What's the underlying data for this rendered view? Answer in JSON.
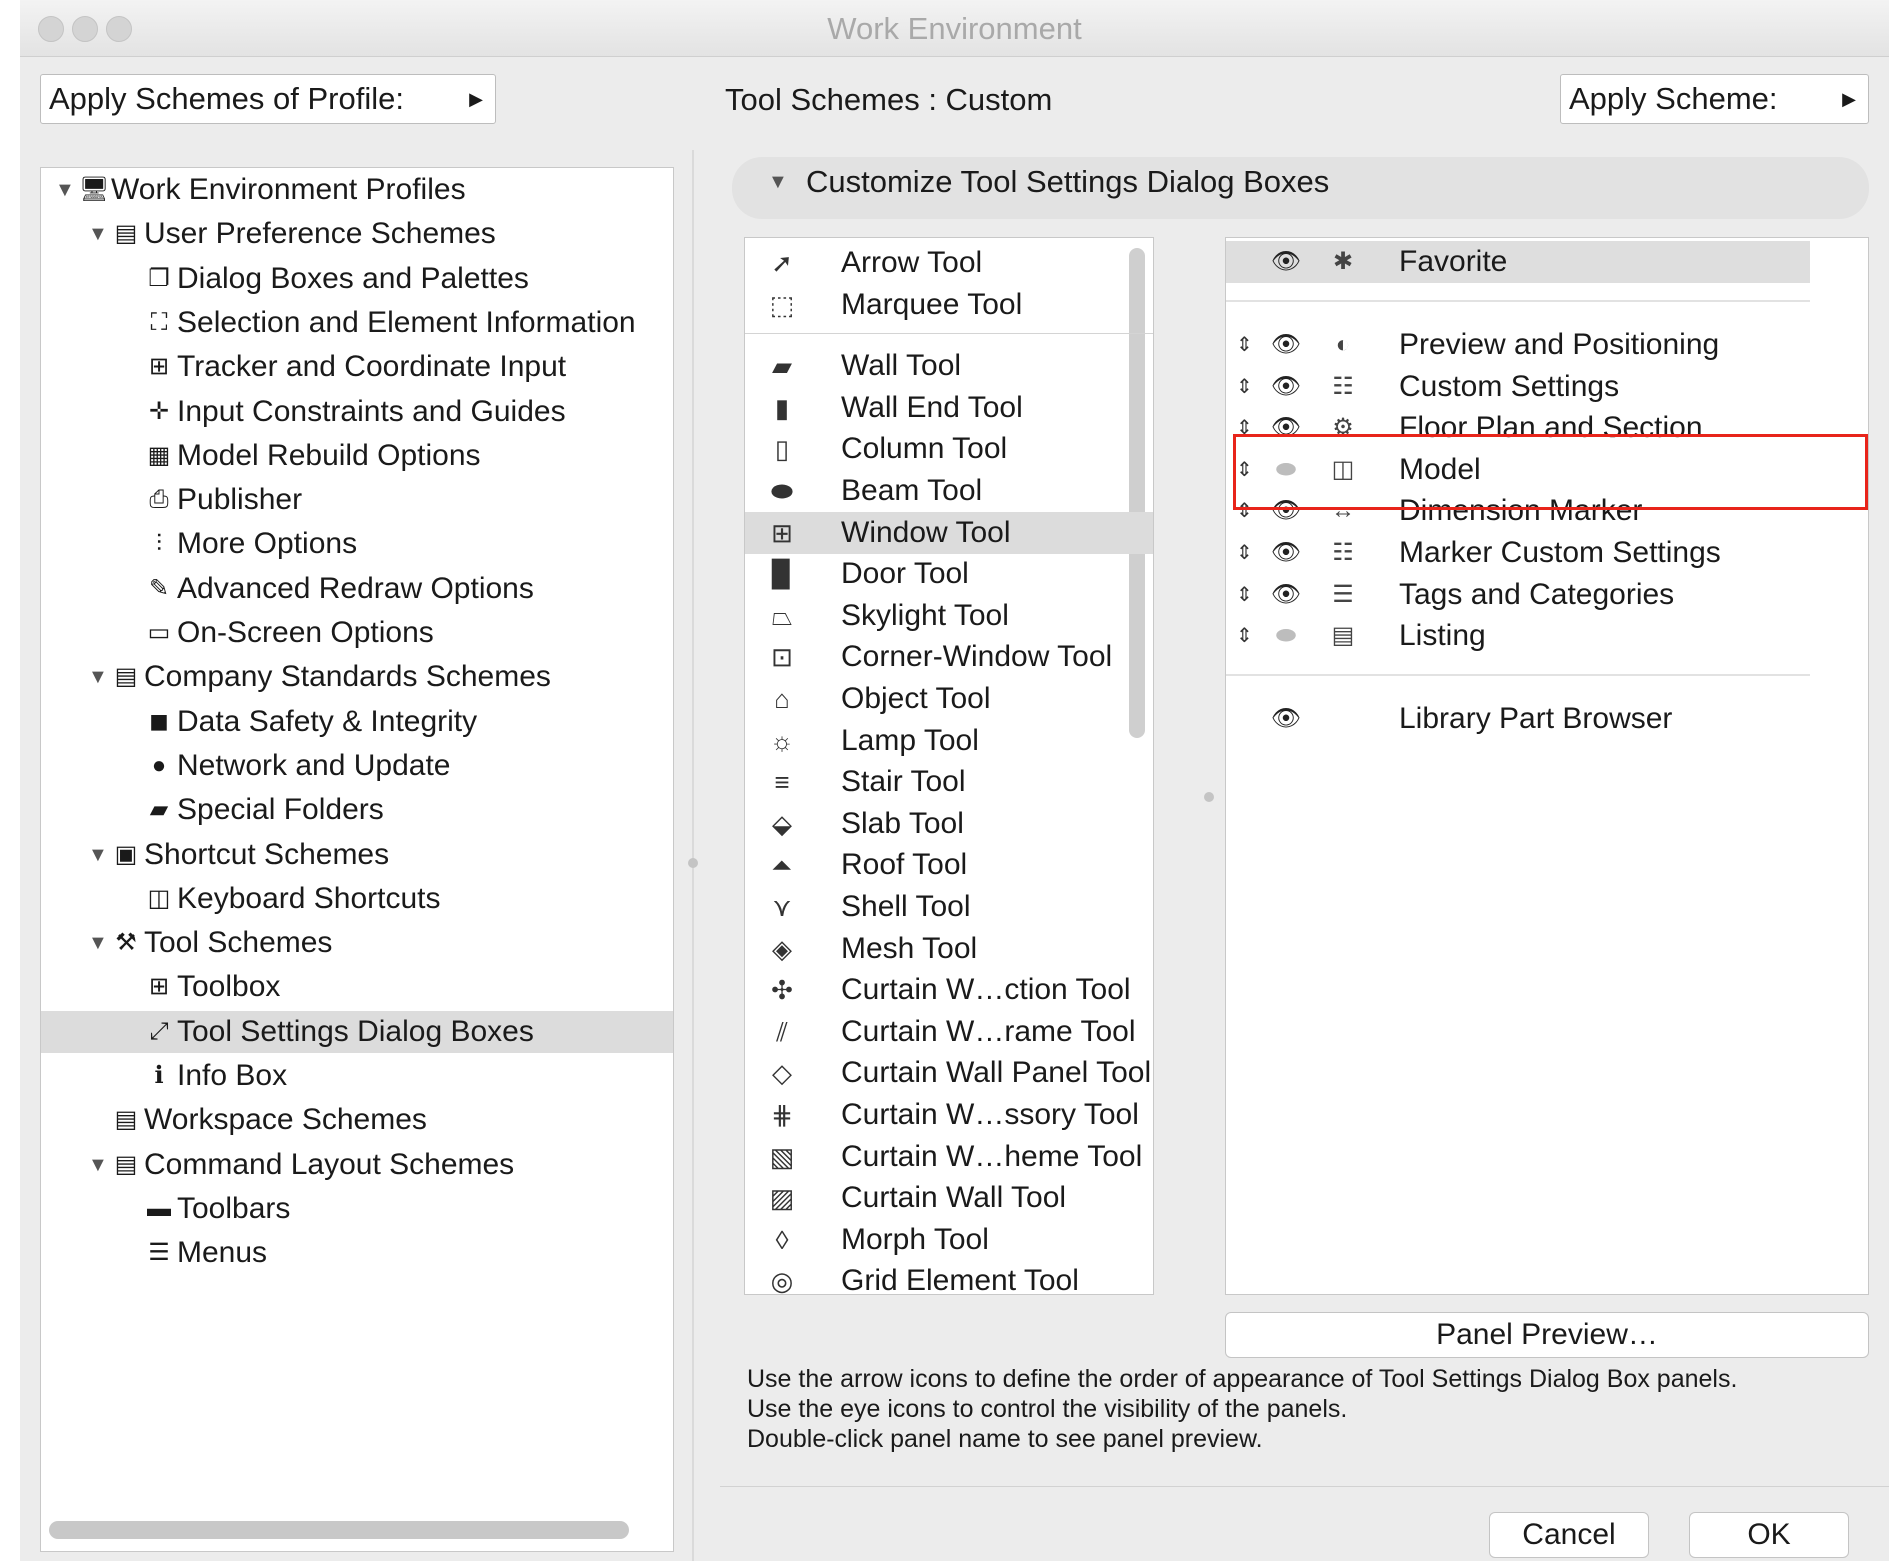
{
  "window": {
    "title": "Work Environment"
  },
  "header": {
    "apply_profile_label": "Apply Schemes of Profile:",
    "scheme_title": "Tool Schemes : Custom",
    "apply_scheme_label": "Apply Scheme:"
  },
  "tree": [
    {
      "label": "Work Environment Profiles",
      "icon": "profiles-icon",
      "level": 0,
      "expanded": true
    },
    {
      "label": "User Preference Schemes",
      "icon": "user-schemes-icon",
      "level": 1,
      "expanded": true
    },
    {
      "label": "Dialog Boxes and Palettes",
      "icon": "dialog-icon",
      "level": 2
    },
    {
      "label": "Selection and Element Information",
      "icon": "selection-icon",
      "level": 2
    },
    {
      "label": "Tracker and Coordinate Input",
      "icon": "tracker-icon",
      "level": 2
    },
    {
      "label": "Input Constraints and Guides",
      "icon": "constraints-icon",
      "level": 2
    },
    {
      "label": "Model Rebuild Options",
      "icon": "rebuild-icon",
      "level": 2
    },
    {
      "label": "Publisher",
      "icon": "publisher-icon",
      "level": 2
    },
    {
      "label": "More Options",
      "icon": "more-options-icon",
      "level": 2
    },
    {
      "label": "Advanced Redraw Options",
      "icon": "redraw-icon",
      "level": 2
    },
    {
      "label": "On-Screen Options",
      "icon": "onscreen-icon",
      "level": 2
    },
    {
      "label": "Company Standards Schemes",
      "icon": "company-schemes-icon",
      "level": 1,
      "expanded": true
    },
    {
      "label": "Data Safety & Integrity",
      "icon": "data-safety-icon",
      "level": 2
    },
    {
      "label": "Network and Update",
      "icon": "globe-icon",
      "level": 2
    },
    {
      "label": "Special Folders",
      "icon": "folder-icon",
      "level": 2
    },
    {
      "label": "Shortcut Schemes",
      "icon": "shortcut-schemes-icon",
      "level": 1,
      "expanded": true
    },
    {
      "label": "Keyboard Shortcuts",
      "icon": "keyboard-icon",
      "level": 2
    },
    {
      "label": "Tool Schemes",
      "icon": "tool-schemes-icon",
      "level": 1,
      "expanded": true
    },
    {
      "label": "Toolbox",
      "icon": "toolbox-icon",
      "level": 2
    },
    {
      "label": "Tool Settings Dialog Boxes",
      "icon": "tool-settings-icon",
      "level": 2,
      "selected": true
    },
    {
      "label": "Info Box",
      "icon": "info-box-icon",
      "level": 2
    },
    {
      "label": "Workspace Schemes",
      "icon": "workspace-icon",
      "level": 1,
      "expanded": false
    },
    {
      "label": "Command Layout Schemes",
      "icon": "command-layout-icon",
      "level": 1,
      "expanded": true
    },
    {
      "label": "Toolbars",
      "icon": "toolbars-icon",
      "level": 2
    },
    {
      "label": "Menus",
      "icon": "menus-icon",
      "level": 2
    }
  ],
  "section": {
    "title": "Customize Tool Settings Dialog Boxes"
  },
  "tools": [
    {
      "label": "Arrow Tool",
      "icon": "arrow-icon",
      "group": 1
    },
    {
      "label": "Marquee Tool",
      "icon": "marquee-icon",
      "group": 1
    },
    {
      "label": "Wall Tool",
      "icon": "wall-icon",
      "group": 2
    },
    {
      "label": "Wall End Tool",
      "icon": "wall-end-icon",
      "group": 2
    },
    {
      "label": "Column Tool",
      "icon": "column-icon",
      "group": 2
    },
    {
      "label": "Beam Tool",
      "icon": "beam-icon",
      "group": 2
    },
    {
      "label": "Window Tool",
      "icon": "window-icon",
      "group": 2,
      "selected": true
    },
    {
      "label": "Door Tool",
      "icon": "door-icon",
      "group": 2
    },
    {
      "label": "Skylight Tool",
      "icon": "skylight-icon",
      "group": 2
    },
    {
      "label": "Corner-Window Tool",
      "icon": "corner-window-icon",
      "group": 2
    },
    {
      "label": "Object Tool",
      "icon": "object-icon",
      "group": 2
    },
    {
      "label": "Lamp Tool",
      "icon": "lamp-icon",
      "group": 2
    },
    {
      "label": "Stair Tool",
      "icon": "stair-icon",
      "group": 2
    },
    {
      "label": "Slab Tool",
      "icon": "slab-icon",
      "group": 2
    },
    {
      "label": "Roof Tool",
      "icon": "roof-icon",
      "group": 2
    },
    {
      "label": "Shell Tool",
      "icon": "shell-icon",
      "group": 2
    },
    {
      "label": "Mesh Tool",
      "icon": "mesh-icon",
      "group": 2
    },
    {
      "label": "Curtain W…ction Tool",
      "icon": "curtain-junction-icon",
      "group": 2
    },
    {
      "label": "Curtain W…rame Tool",
      "icon": "curtain-frame-icon",
      "group": 2
    },
    {
      "label": "Curtain Wall Panel Tool",
      "icon": "curtain-panel-icon",
      "group": 2
    },
    {
      "label": "Curtain W…ssory Tool",
      "icon": "curtain-accessory-icon",
      "group": 2
    },
    {
      "label": "Curtain W…heme Tool",
      "icon": "curtain-scheme-icon",
      "group": 2
    },
    {
      "label": "Curtain Wall Tool",
      "icon": "curtain-wall-icon",
      "group": 2
    },
    {
      "label": "Morph Tool",
      "icon": "morph-icon",
      "group": 2
    },
    {
      "label": "Grid Element Tool",
      "icon": "grid-element-icon",
      "group": 2,
      "partial": true
    }
  ],
  "panels": {
    "favorite": {
      "label": "Favorite",
      "icon": "favorite-icon",
      "visible": true
    },
    "items": [
      {
        "label": "Preview and Positioning",
        "icon": "preview-positioning-icon",
        "visible": true
      },
      {
        "label": "Custom Settings",
        "icon": "custom-settings-icon",
        "visible": true
      },
      {
        "label": "Floor Plan and Section",
        "icon": "floor-plan-icon",
        "visible": true
      },
      {
        "label": "Model",
        "icon": "model-icon",
        "visible": false,
        "highlighted": true
      },
      {
        "label": "Dimension Marker",
        "icon": "dimension-marker-icon",
        "visible": true
      },
      {
        "label": "Marker Custom Settings",
        "icon": "marker-custom-icon",
        "visible": true
      },
      {
        "label": "Tags and Categories",
        "icon": "tags-icon",
        "visible": true
      },
      {
        "label": "Listing",
        "icon": "listing-icon",
        "visible": false
      }
    ],
    "footer": {
      "label": "Library Part Browser",
      "visible": true
    }
  },
  "buttons": {
    "panel_preview": "Panel Preview…",
    "cancel": "Cancel",
    "ok": "OK"
  },
  "help_text": [
    "Use the arrow icons to define the order of appearance of Tool Settings Dialog Box panels.",
    "Use the eye icons to control the visibility of the panels.",
    "Double-click panel name to see panel preview."
  ],
  "colors": {
    "highlight_box": "#e8241a",
    "selection": "#dcdcdc"
  }
}
